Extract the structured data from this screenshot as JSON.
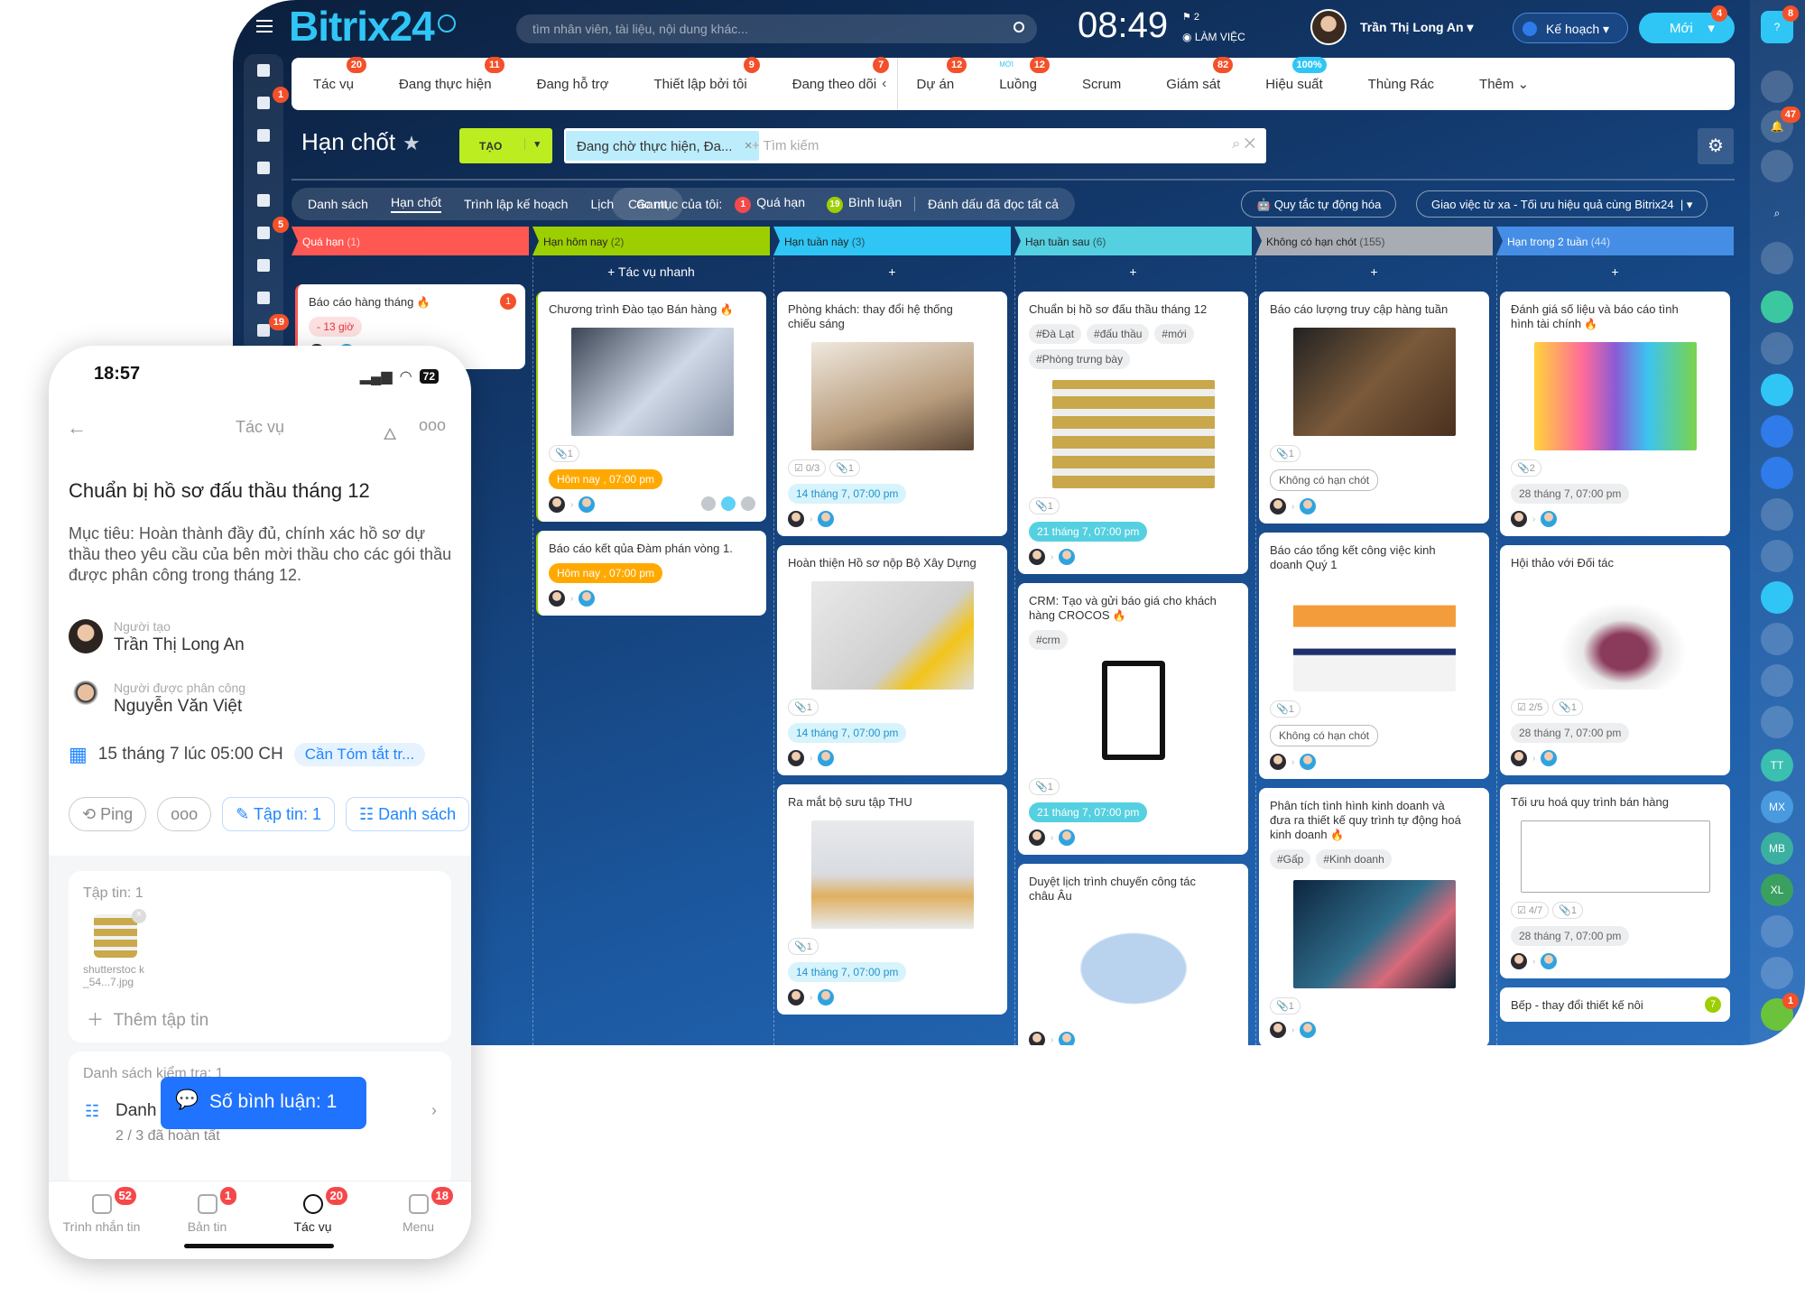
{
  "header": {
    "logo_main": "Bitrix",
    "logo_num": "24",
    "search_placeholder": "tìm nhân viên, tài liệu, nội dung khác...",
    "time": "08:49",
    "flag_count": "2",
    "status": "LÀM VIỆC",
    "user_name": "Trần Thị Long An",
    "plan_label": "Kế hoạch",
    "new_label": "Mới",
    "new_badge": "4",
    "help_badge": "8"
  },
  "left_sidebar": [
    {
      "icon": "feed-icon"
    },
    {
      "icon": "newsfeed-icon",
      "badge": "1"
    },
    {
      "icon": "calendar-icon"
    },
    {
      "icon": "document-icon"
    },
    {
      "icon": "drive-icon"
    },
    {
      "icon": "chat-icon",
      "badge": "5"
    },
    {
      "icon": "mail-icon"
    },
    {
      "icon": "group-icon"
    },
    {
      "icon": "tasks-icon",
      "badge": "19"
    }
  ],
  "nav": {
    "tabs": [
      {
        "label": "Tác vụ",
        "badge": "20"
      },
      {
        "label": "Đang thực hiện",
        "badge": "11"
      },
      {
        "label": "Đang hỗ trợ"
      },
      {
        "label": "Thiết lập bởi tôi",
        "badge": "9"
      },
      {
        "label": "Đang theo dõi",
        "badge": "7"
      }
    ],
    "tabs2": [
      {
        "label": "Dự án",
        "badge": "12"
      },
      {
        "label": "Luồng",
        "badge": "12",
        "tag": "MỚI"
      },
      {
        "label": "Scrum"
      },
      {
        "label": "Giám sát",
        "badge": "82"
      },
      {
        "label": "Hiệu suất",
        "badge": "100%"
      },
      {
        "label": "Thùng Rác"
      },
      {
        "label": "Thêm ⌄"
      }
    ]
  },
  "page": {
    "title": "Hạn chốt",
    "create_label": "TẠO",
    "filter_chip": "Đang chờ thực hiện, Đa...",
    "search_placeholder": "+ Tìm kiếm"
  },
  "toolbar": {
    "views": [
      "Danh sách",
      "Hạn chốt",
      "Trình lập kế hoạch",
      "Lịch",
      "Gantt"
    ],
    "active_view": "Hạn chốt",
    "my_items_label": "Các mục của tôi:",
    "overdue_count": "1",
    "overdue_label": "Quá hạn",
    "comments_count": "19",
    "comments_label": "Bình luận",
    "mark_read": "Đánh dấu đã đọc tất cả",
    "automation": "Quy tắc tự động hóa",
    "promo": "Giao việc từ xa - Tối ưu hiệu quả cùng Bitrix24"
  },
  "columns": [
    {
      "title": "Quá hạn",
      "count": "(1)",
      "color": "#ff5752",
      "quick_add": "",
      "cards": [
        {
          "title": "Báo cáo hàng tháng",
          "fire": true,
          "badge": "1",
          "date": "- 13 giờ",
          "date_style": "red"
        }
      ]
    },
    {
      "title": "Hạn hôm nay",
      "count": "(2)",
      "color": "#9dcf00",
      "dark_text": true,
      "quick_add": "+ Tác vụ nhanh",
      "cards": [
        {
          "title": "Chương trình Đào tạo Bán hàng",
          "fire": true,
          "image": "laptop-analytics-photo",
          "files": "1",
          "date": "Hôm nay , 07:00 pm",
          "date_style": "orange",
          "actions": true
        },
        {
          "title": "Báo cáo kết qủa Đàm phán vòng 1.",
          "date": "Hôm nay , 07:00 pm",
          "date_style": "orange"
        }
      ]
    },
    {
      "title": "Hạn tuần này",
      "count": "(3)",
      "color": "#2fc6f6",
      "dark_text": true,
      "quick_add": "+",
      "cards": [
        {
          "title": "Phòng khách: thay đổi hệ thống chiếu sáng",
          "image": "living-room-photo",
          "checklist": "0/3",
          "files": "1",
          "date": "14 tháng 7, 07:00 pm",
          "date_style": "lblue"
        },
        {
          "title": "Hoàn thiện Hồ sơ nộp Bộ Xây Dựng",
          "image": "construction-plans-photo",
          "files": "1",
          "date": "14 tháng 7, 07:00 pm",
          "date_style": "lblue"
        },
        {
          "title": "Ra mắt bộ sưu tập THU",
          "image": "furniture-collection-photo",
          "files": "1",
          "date": "14 tháng 7, 07:00 pm",
          "date_style": "lblue"
        }
      ]
    },
    {
      "title": "Hạn tuần sau",
      "count": "(6)",
      "color": "#55d0e0",
      "dark_text": true,
      "quick_add": "+",
      "cards": [
        {
          "title": "Chuẩn bị hồ sơ đấu thầu tháng 12",
          "tags": [
            "#Đà Lạt",
            "#đấu thầu",
            "#mới",
            "#Phòng trưng bày"
          ],
          "image": "tender-folders-photo",
          "files": "1",
          "date": "21 tháng 7, 07:00 pm",
          "date_style": "teal"
        },
        {
          "title": "CRM: Tạo và gửi báo giá cho khách hàng CROCOS",
          "fire": true,
          "tags": [
            "#crm"
          ],
          "image": "invoice-icon-image",
          "files": "1",
          "date": "21 tháng 7, 07:00 pm",
          "date_style": "teal"
        },
        {
          "title": "Duyệt lịch trình chuyến công tác châu Âu",
          "image": "europe-map-image"
        }
      ]
    },
    {
      "title": "Không có hạn chót",
      "count": "(155)",
      "color": "#a8adb4",
      "dark_text": true,
      "quick_add": "+",
      "cards": [
        {
          "title": "Báo cáo lượng truy cập hàng tuần",
          "image": "tablet-dashboard-photo",
          "files": "1",
          "date": "Không có hạn chót",
          "date_style": "outline"
        },
        {
          "title": "Báo cáo tổng kết công việc kinh doanh Quý 1",
          "image": "executive-summary-slide",
          "files": "1",
          "date": "Không có hạn chót",
          "date_style": "outline"
        },
        {
          "title": "Phân tích tình hình kinh doanh và đưa ra thiết kế quy trình tự động hoá kinh doanh",
          "fire": true,
          "tags": [
            "#Gấp",
            "#Kinh doanh"
          ],
          "image": "business-analysis-photo",
          "files": "1"
        }
      ]
    },
    {
      "title": "Hạn trong 2 tuần",
      "count": "(44)",
      "color": "#468ee5",
      "quick_add": "+",
      "cards": [
        {
          "title": "Đánh giá số liệu và báo cáo tình hình tài chính",
          "fire": true,
          "image": "3d-bar-chart-image",
          "files": "2",
          "date": "28 tháng 7, 07:00 pm",
          "date_style": "gray"
        },
        {
          "title": "Hội thảo với Đối tác",
          "image": "meeting-illustration",
          "checklist": "2/5",
          "files": "1",
          "date": "28 tháng 7, 07:00 pm",
          "date_style": "gray"
        },
        {
          "title": "Tối ưu hoá quy trình bán hàng",
          "image": "process-diagram-image",
          "checklist": "4/7",
          "files": "1",
          "date": "28 tháng 7, 07:00 pm",
          "date_style": "gray"
        },
        {
          "title": "Bếp - thay đổi thiết kế nôi",
          "badge": "7",
          "badge_green": true
        }
      ]
    }
  ],
  "right_sidebar": {
    "bell_badge": "47",
    "initials": [
      "TT",
      "MX",
      "MB",
      "XL"
    ],
    "last_badge": "1"
  },
  "phone": {
    "time": "18:57",
    "battery": "72",
    "header_title": "Tác vụ",
    "task_title": "Chuẩn bị hồ sơ đấu thầu tháng 12",
    "description": "Mục tiêu: Hoàn thành đầy đủ, chính xác hồ sơ dự thầu theo yêu cầu của bên mời thầu cho các gói thầu được phân công trong tháng 12.",
    "creator_label": "Người tạo",
    "creator_name": "Trần Thị Long An",
    "assignee_label": "Người được phân công",
    "assignee_name": "Nguyễn Văn Việt",
    "deadline": "15 tháng 7 lúc 05:00 CH",
    "deadline_chip": "Cần Tóm tắt tr...",
    "ping": "Ping",
    "files_btn": "Tập tin: 1",
    "checklist_btn": "Danh sách",
    "files_title": "Tập tin: 1",
    "file_name": "shutterstoc k_54...7.jpg",
    "add_file": "Thêm tập tin",
    "checklist_title": "Danh sách kiểm tra: 1",
    "checklist_name": "Danh",
    "checklist_progress": "2 / 3 đã hoàn tất",
    "toast": "Số bình luận: 1",
    "bottom_nav": [
      {
        "label": "Trình nhắn tin",
        "badge": "52"
      },
      {
        "label": "Bản tin",
        "badge": "1"
      },
      {
        "label": "Tác vụ",
        "badge": "20",
        "active": true
      },
      {
        "label": "Menu",
        "badge": "18"
      }
    ]
  }
}
